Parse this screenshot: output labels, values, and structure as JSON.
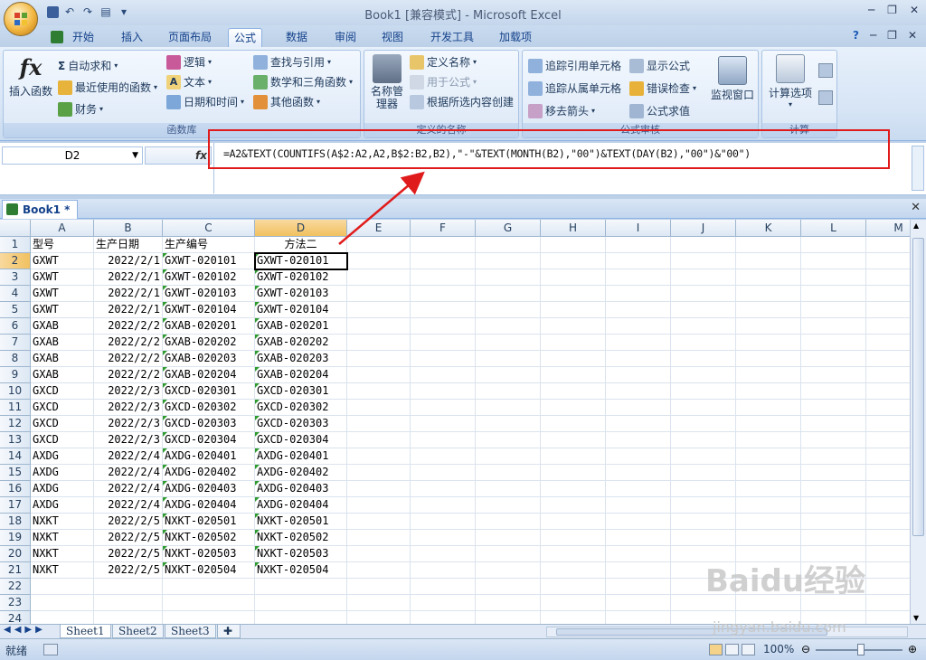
{
  "window": {
    "title": "Book1  [兼容模式] - Microsoft Excel"
  },
  "ribbon_tabs": [
    "开始",
    "插入",
    "页面布局",
    "公式",
    "数据",
    "审阅",
    "视图",
    "开发工具",
    "加载项"
  ],
  "active_tab": "公式",
  "groups": {
    "function_library": {
      "label": "函数库",
      "insert_function": "插入函数",
      "autosum": "自动求和",
      "recent": "最近使用的函数",
      "financial": "财务",
      "logical": "逻辑",
      "text": "文本",
      "datetime": "日期和时间",
      "lookup": "查找与引用",
      "math": "数学和三角函数",
      "more": "其他函数"
    },
    "defined_names": {
      "label": "定义的名称",
      "name_manager": "名称管理器",
      "define_name": "定义名称",
      "use_in_formula": "用于公式",
      "create_from_selection": "根据所选内容创建"
    },
    "formula_auditing": {
      "label": "公式审核",
      "trace_precedents": "追踪引用单元格",
      "trace_dependents": "追踪从属单元格",
      "remove_arrows": "移去箭头",
      "show_formulas": "显示公式",
      "error_checking": "错误检查",
      "evaluate_formula": "公式求值",
      "watch_window": "监视窗口"
    },
    "calculation": {
      "label": "计算",
      "options": "计算选项"
    }
  },
  "formula_bar": {
    "name_box": "D2",
    "fx": "fx",
    "formula": "=A2&TEXT(COUNTIFS(A$2:A2,A2,B$2:B2,B2),\"-\"&TEXT(MONTH(B2),\"00\")&TEXT(DAY(B2),\"00\")&\"00\")"
  },
  "workbook_tab": "Book1 *",
  "columns": [
    "A",
    "B",
    "C",
    "D",
    "E",
    "F",
    "G",
    "H",
    "I",
    "J",
    "K",
    "L",
    "M"
  ],
  "headers": {
    "A": "型号",
    "B": "生产日期",
    "C": "生产编号",
    "D": "方法二"
  },
  "rows": [
    [
      "GXWT",
      "2022/2/1",
      "GXWT-020101",
      "GXWT-020101"
    ],
    [
      "GXWT",
      "2022/2/1",
      "GXWT-020102",
      "GXWT-020102"
    ],
    [
      "GXWT",
      "2022/2/1",
      "GXWT-020103",
      "GXWT-020103"
    ],
    [
      "GXWT",
      "2022/2/1",
      "GXWT-020104",
      "GXWT-020104"
    ],
    [
      "GXAB",
      "2022/2/2",
      "GXAB-020201",
      "GXAB-020201"
    ],
    [
      "GXAB",
      "2022/2/2",
      "GXAB-020202",
      "GXAB-020202"
    ],
    [
      "GXAB",
      "2022/2/2",
      "GXAB-020203",
      "GXAB-020203"
    ],
    [
      "GXAB",
      "2022/2/2",
      "GXAB-020204",
      "GXAB-020204"
    ],
    [
      "GXCD",
      "2022/2/3",
      "GXCD-020301",
      "GXCD-020301"
    ],
    [
      "GXCD",
      "2022/2/3",
      "GXCD-020302",
      "GXCD-020302"
    ],
    [
      "GXCD",
      "2022/2/3",
      "GXCD-020303",
      "GXCD-020303"
    ],
    [
      "GXCD",
      "2022/2/3",
      "GXCD-020304",
      "GXCD-020304"
    ],
    [
      "AXDG",
      "2022/2/4",
      "AXDG-020401",
      "AXDG-020401"
    ],
    [
      "AXDG",
      "2022/2/4",
      "AXDG-020402",
      "AXDG-020402"
    ],
    [
      "AXDG",
      "2022/2/4",
      "AXDG-020403",
      "AXDG-020403"
    ],
    [
      "AXDG",
      "2022/2/4",
      "AXDG-020404",
      "AXDG-020404"
    ],
    [
      "NXKT",
      "2022/2/5",
      "NXKT-020501",
      "NXKT-020501"
    ],
    [
      "NXKT",
      "2022/2/5",
      "NXKT-020502",
      "NXKT-020502"
    ],
    [
      "NXKT",
      "2022/2/5",
      "NXKT-020503",
      "NXKT-020503"
    ],
    [
      "NXKT",
      "2022/2/5",
      "NXKT-020504",
      "NXKT-020504"
    ]
  ],
  "row_numbers": [
    "1",
    "2",
    "3",
    "4",
    "5",
    "6",
    "7",
    "8",
    "9",
    "10",
    "11",
    "12",
    "13",
    "14",
    "15",
    "16",
    "17",
    "18",
    "19",
    "20",
    "21",
    "22",
    "23",
    "24"
  ],
  "sheets": [
    "Sheet1",
    "Sheet2",
    "Sheet3"
  ],
  "status": {
    "ready": "就绪",
    "zoom": "100%"
  },
  "watermark": {
    "logo": "Baidu经验",
    "url": "jingyan.baidu.com"
  },
  "colors": {
    "annotation": "#e01b1b",
    "ribbon_text": "#1e395b"
  }
}
